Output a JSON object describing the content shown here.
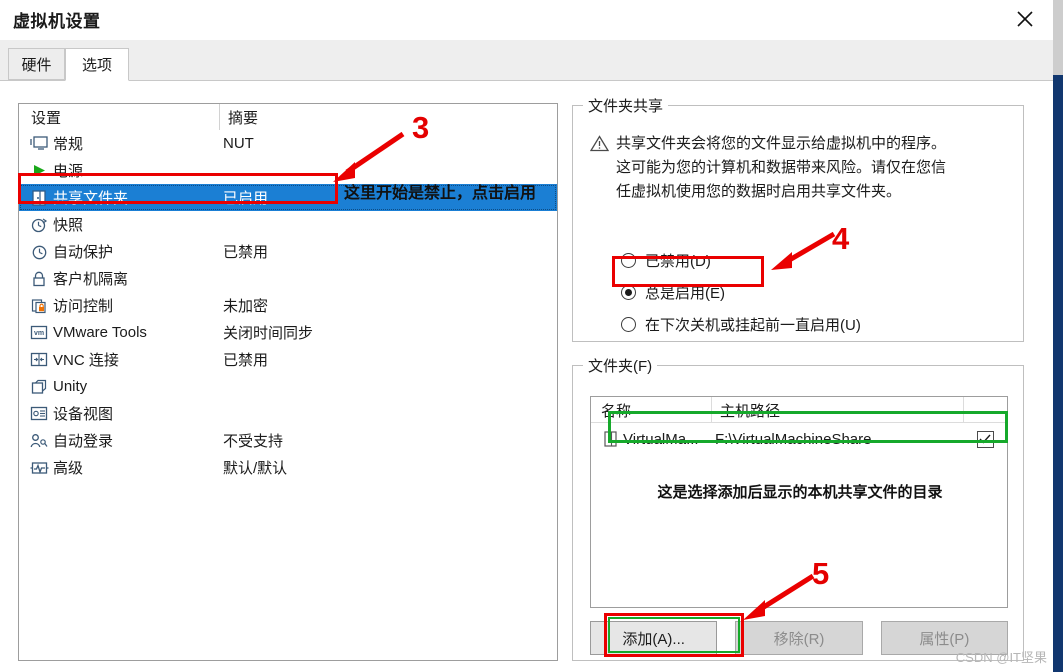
{
  "window": {
    "title": "虚拟机设置",
    "close_icon": "close-icon"
  },
  "tabs": [
    {
      "label": "硬件",
      "active": false
    },
    {
      "label": "选项",
      "active": true
    }
  ],
  "settings_list": {
    "columns": [
      "设置",
      "摘要"
    ],
    "rows": [
      {
        "icon": "monitor-icon",
        "name": "常规",
        "summary": "NUT",
        "selected": false
      },
      {
        "icon": "power-play-icon",
        "name": "电源",
        "summary": "",
        "selected": false
      },
      {
        "icon": "shared-folder-icon",
        "name": "共享文件夹",
        "summary": "已启用",
        "selected": true
      },
      {
        "icon": "snapshot-clock-icon",
        "name": "快照",
        "summary": "",
        "selected": false
      },
      {
        "icon": "autoprotect-icon",
        "name": "自动保护",
        "summary": "已禁用",
        "selected": false
      },
      {
        "icon": "lock-icon",
        "name": "客户机隔离",
        "summary": "",
        "selected": false
      },
      {
        "icon": "access-control-icon",
        "name": "访问控制",
        "summary": "未加密",
        "selected": false
      },
      {
        "icon": "vmware-tools-icon",
        "name": "VMware Tools",
        "summary": "关闭时间同步",
        "selected": false
      },
      {
        "icon": "vnc-icon",
        "name": "VNC 连接",
        "summary": "已禁用",
        "selected": false
      },
      {
        "icon": "unity-icon",
        "name": "Unity",
        "summary": "",
        "selected": false
      },
      {
        "icon": "device-view-icon",
        "name": "设备视图",
        "summary": "",
        "selected": false
      },
      {
        "icon": "auto-login-icon",
        "name": "自动登录",
        "summary": "不受支持",
        "selected": false
      },
      {
        "icon": "advanced-icon",
        "name": "高级",
        "summary": "默认/默认",
        "selected": false
      }
    ]
  },
  "folder_sharing": {
    "legend": "文件夹共享",
    "warning_icon": "warning-triangle-icon",
    "warning_text": "共享文件夹会将您的文件显示给虚拟机中的程序。这可能为您的计算机和数据带来风险。请仅在您信任虚拟机使用您的数据时启用共享文件夹。",
    "options": [
      {
        "label": "已禁用(D)",
        "selected": false
      },
      {
        "label": "总是启用(E)",
        "selected": true
      },
      {
        "label": "在下次关机或挂起前一直启用(U)",
        "selected": false
      }
    ]
  },
  "folders": {
    "legend": "文件夹(F)",
    "columns": [
      "名称",
      "主机路径",
      ""
    ],
    "rows": [
      {
        "icon": "folder-icon",
        "name": "VirtualMa...",
        "host_path": "F:\\VirtualMachineShare",
        "checked": true,
        "check_icon": "check-icon"
      }
    ],
    "buttons": [
      {
        "label": "添加(A)...",
        "enabled": true
      },
      {
        "label": "移除(R)",
        "enabled": false
      },
      {
        "label": "属性(P)",
        "enabled": false
      }
    ]
  },
  "annotations": {
    "step3_number": "3",
    "step3_text": "这里开始是禁止，点击启用",
    "step4_number": "4",
    "step5_number": "5",
    "folder_note": "这是选择添加后显示的本机共享文件的目录"
  },
  "watermark": "CSDN @IT坚果",
  "colors": {
    "selection_blue": "#1b7fd4",
    "annotation_red": "#ea0000",
    "annotation_green": "#16a92b",
    "scrollbar_blue": "#11376f"
  }
}
